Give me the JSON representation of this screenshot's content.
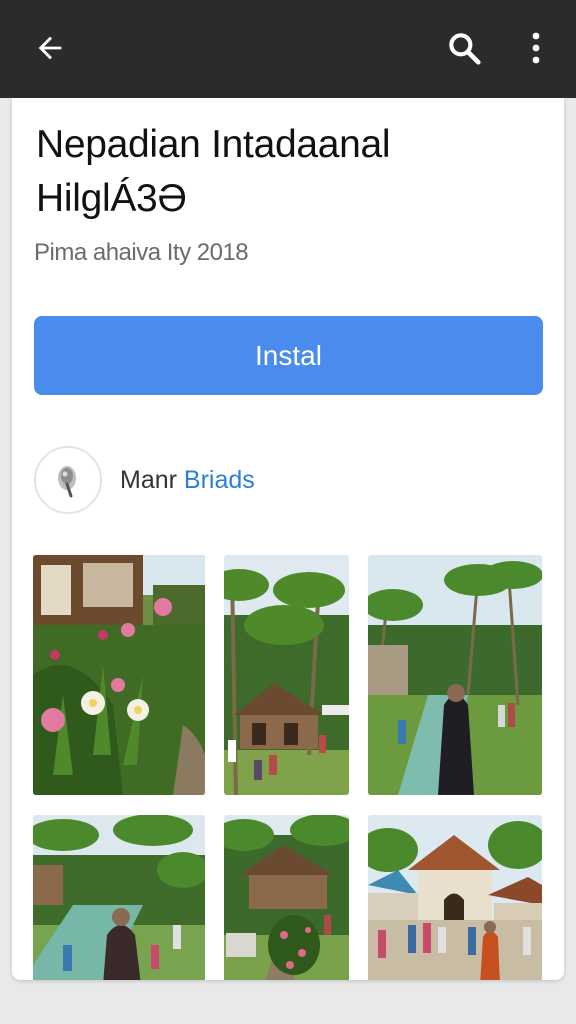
{
  "app_bar": {
    "back_icon": "arrow-back-icon",
    "search_icon": "search-icon",
    "more_icon": "more-vert-icon",
    "background": "#2b2b2b"
  },
  "app": {
    "title_line1": "Nepadian Intadaanal",
    "title_line2": "HilglÁ3Ә",
    "subtitle": "Pima ahaiva Ity 2018",
    "install_label": "Instal",
    "install_color": "#4a8ced",
    "developer_prefix": "Manr ",
    "developer_accent": "Briads",
    "developer_icon": "developer-logo-icon"
  },
  "screenshots": [
    {
      "scene": "garden flowers beside wooden house"
    },
    {
      "scene": "palm trees and thatched pavilion with visitors"
    },
    {
      "scene": "monk standing by green canal under palms"
    },
    {
      "scene": "monk and visitors by canal in palm garden"
    },
    {
      "scene": "thatched hut surrounded by flowers"
    },
    {
      "scene": "temple building with crowd of visitors"
    }
  ]
}
